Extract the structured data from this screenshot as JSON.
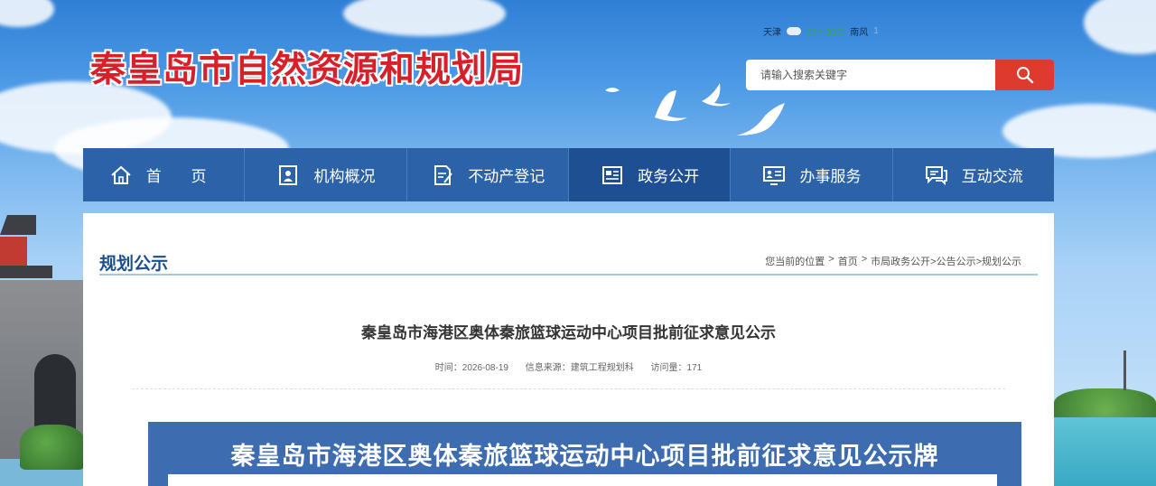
{
  "header": {
    "site_title": "秦皇岛市自然资源和规划局",
    "weather": {
      "city": "天津",
      "temperature": "25～33℃",
      "wind": "南风",
      "wind_strength": "1"
    },
    "search": {
      "placeholder": "请输入搜索关键字",
      "button_icon": "search-icon"
    }
  },
  "nav": {
    "items": [
      {
        "label": "首 页",
        "icon": "home-icon"
      },
      {
        "label": "机构概况",
        "icon": "org-icon"
      },
      {
        "label": "不动产登记",
        "icon": "register-icon"
      },
      {
        "label": "政务公开",
        "icon": "gov-info-icon",
        "active": true
      },
      {
        "label": "办事服务",
        "icon": "service-icon"
      },
      {
        "label": "互动交流",
        "icon": "chat-icon"
      }
    ]
  },
  "section": {
    "title": "规划公示",
    "breadcrumb": {
      "prefix": "您当前的位置",
      "sep1": ">",
      "home": "首页",
      "sep2": ">",
      "trail": "市局政务公开>公告公示>规划公示"
    }
  },
  "article": {
    "title": "秦皇岛市海港区奥体秦旅篮球运动中心项目批前征求意见公示",
    "meta": {
      "time": "时间：2026-08-19",
      "source": "信息来源：建筑工程规划科",
      "views": "访问量：171"
    },
    "notice_board_title": "秦皇岛市海港区奥体秦旅篮球运动中心项目批前征求意见公示牌"
  },
  "colors": {
    "nav_bg": "#2b62a8",
    "nav_active": "#1f4f93",
    "title_red": "#d8202a",
    "search_button": "#de3b2e",
    "section_blue": "#1d4f8c"
  }
}
